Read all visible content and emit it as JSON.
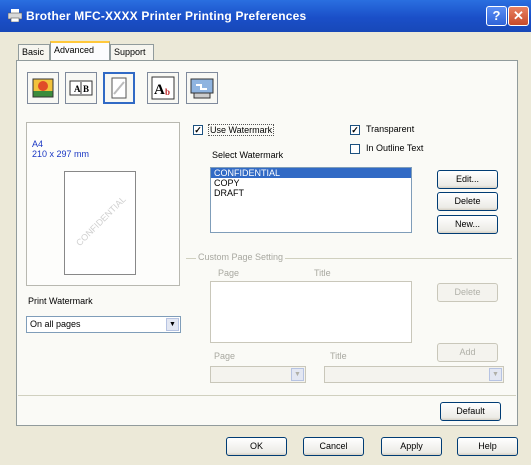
{
  "window": {
    "title": "Brother MFC-XXXX Printer Printing Preferences"
  },
  "tabs": [
    "Basic",
    "Advanced",
    "Support"
  ],
  "toolbar": {
    "icons": [
      "color-icon",
      "scaling-icon",
      "watermark-icon",
      "text-style-icon",
      "settings-icon"
    ]
  },
  "preview": {
    "paper_size": "A4",
    "paper_dims": "210 x 297 mm",
    "watermark_text": "CONFIDENTIAL"
  },
  "print_watermark": {
    "label": "Print Watermark",
    "value": "On all pages"
  },
  "watermark": {
    "use_label": "Use Watermark",
    "transparent_label": "Transparent",
    "outline_label": "In Outline Text",
    "select_label": "Select Watermark",
    "items": [
      "CONFIDENTIAL",
      "COPY",
      "DRAFT"
    ],
    "edit_label": "Edit...",
    "delete_label": "Delete",
    "new_label": "New..."
  },
  "custom": {
    "group_label": "Custom Page Setting",
    "page_label": "Page",
    "title_label": "Title",
    "delete_label": "Delete",
    "add_label": "Add",
    "page_label2": "Page",
    "title_label2": "Title"
  },
  "default_label": "Default",
  "footer": {
    "ok": "OK",
    "cancel": "Cancel",
    "apply": "Apply",
    "help": "Help"
  }
}
